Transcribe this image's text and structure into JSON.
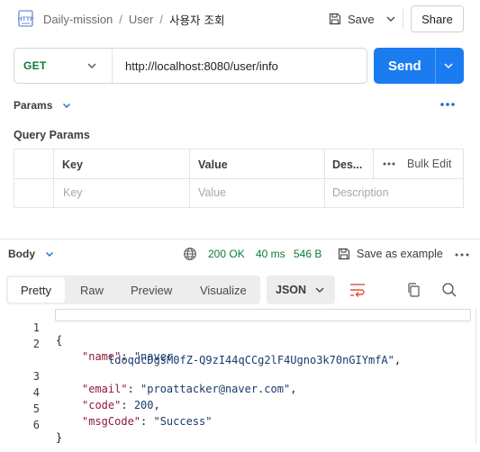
{
  "header": {
    "http_badge_icon": "http-file-icon",
    "breadcrumb": [
      "Daily-mission",
      "User",
      "사용자 조회"
    ],
    "separator": "/",
    "save_label": "Save",
    "share_label": "Share"
  },
  "request": {
    "method": "GET",
    "url": "http://localhost:8080/user/info",
    "send_label": "Send",
    "method_color": "#0b7a38",
    "send_color": "#1b7cf0"
  },
  "params": {
    "tab_label": "Params",
    "query_title": "Query Params",
    "columns": [
      "Key",
      "Value",
      "Des..."
    ],
    "bulk_edit": "Bulk Edit",
    "placeholders": [
      "Key",
      "Value",
      "Description"
    ]
  },
  "response": {
    "tab_label": "Body",
    "status": "200 OK",
    "time": "40 ms",
    "size": "546 B",
    "save_example": "Save as example",
    "view_tabs": [
      "Pretty",
      "Raw",
      "Preview",
      "Visualize"
    ],
    "active_view": "Pretty",
    "format": "JSON",
    "status_color": "#0b7a38",
    "line_numbers": [
      "1",
      "2",
      "",
      "3",
      "4",
      "5",
      "6"
    ],
    "json": {
      "open": "{",
      "name_key": "\"name\"",
      "name_val_1": "\"naver",
      "name_val_2": "ldoqdcDgsM0fZ-Q9zI44qCCg2lF4Ugno3k70nGIYmfA\"",
      "email_key": "\"email\"",
      "email_val": "\"proattacker@naver.com\"",
      "code_key": "\"code\"",
      "code_val": "200",
      "msg_key": "\"msgCode\"",
      "msg_val": "\"Success\"",
      "close": "}"
    }
  }
}
